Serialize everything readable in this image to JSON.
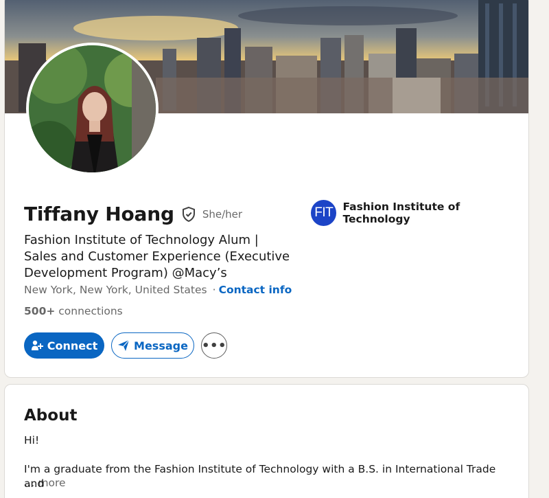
{
  "profile": {
    "name": "Tiffany Hoang",
    "pronouns": "She/her",
    "headline": "Fashion Institute of Technology Alum | Sales and Customer Experience (Executive Development Program) @Macy’s",
    "location": "New York, New York, United States",
    "separator": "·",
    "contact_info_label": "Contact info",
    "connections_count": "500+",
    "connections_label": "connections",
    "education": {
      "name": "Fashion Institute of Technology",
      "logo_text": "FIT",
      "logo_color": "#1c44c7"
    }
  },
  "actions": {
    "connect_label": "Connect",
    "message_label": "Message",
    "more_label": "•••"
  },
  "about": {
    "title": "About",
    "greeting": "Hi!",
    "text": "I'm a graduate from the Fashion Institute of Technology with a B.S. in International Trade and",
    "ellipsis": "…",
    "more_label": "more"
  },
  "colors": {
    "accent": "#0a66c2",
    "background": "#f4f2ee"
  },
  "icons": [
    "verified-shield-icon",
    "add-person-icon",
    "send-icon",
    "more-icon"
  ]
}
